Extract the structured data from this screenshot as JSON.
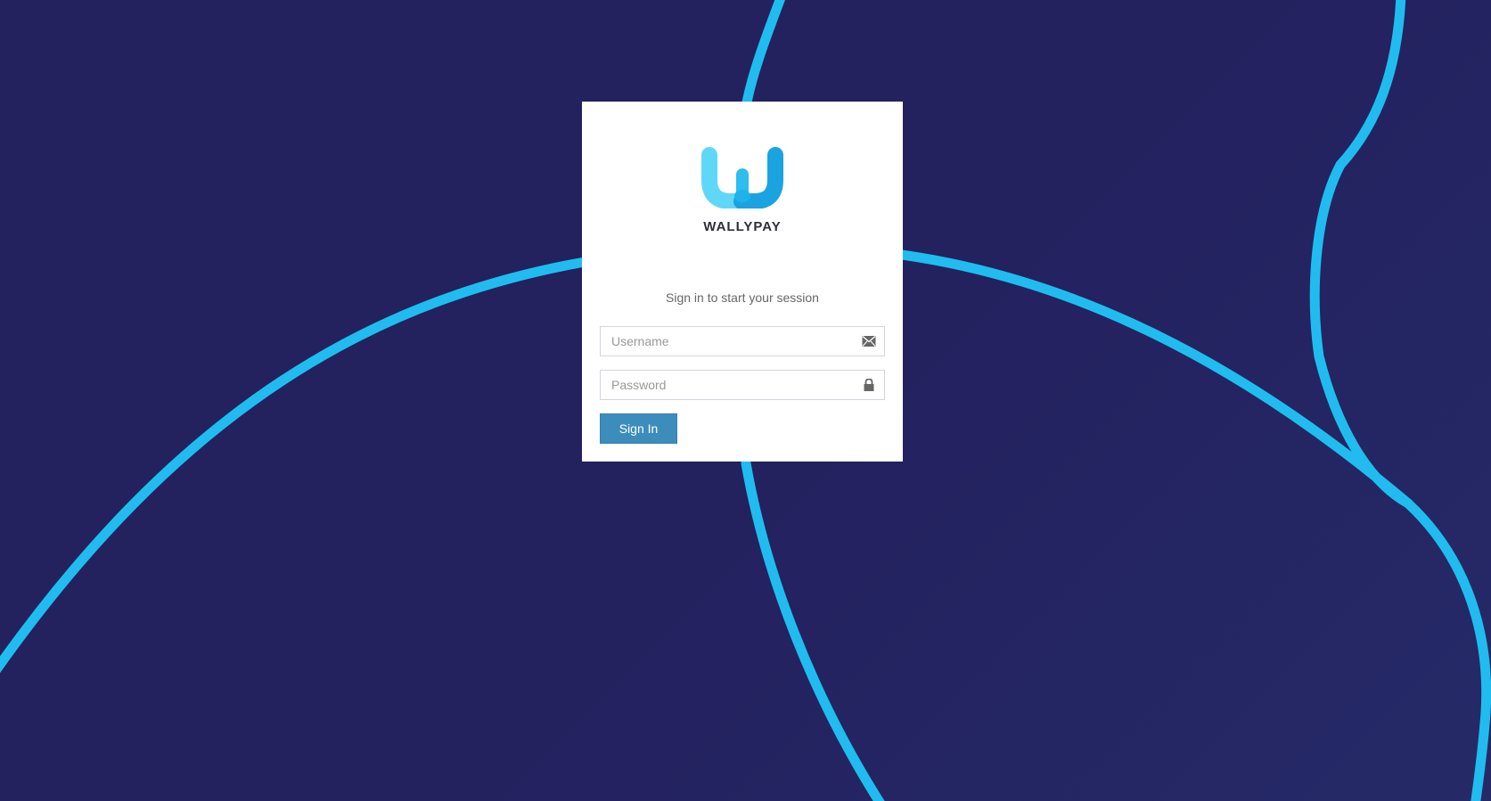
{
  "brand": {
    "name": "WALLYPAY"
  },
  "login": {
    "message": "Sign in to start your session",
    "username_placeholder": "Username",
    "password_placeholder": "Password",
    "signin_label": "Sign In"
  },
  "icons": {
    "username": "envelope-icon",
    "password": "lock-icon"
  },
  "colors": {
    "background": "#24215f",
    "curves": "#21bcef",
    "button": "#3c8dbc",
    "logo_light": "#5fd8f7",
    "logo_dark": "#1aa3e0"
  }
}
